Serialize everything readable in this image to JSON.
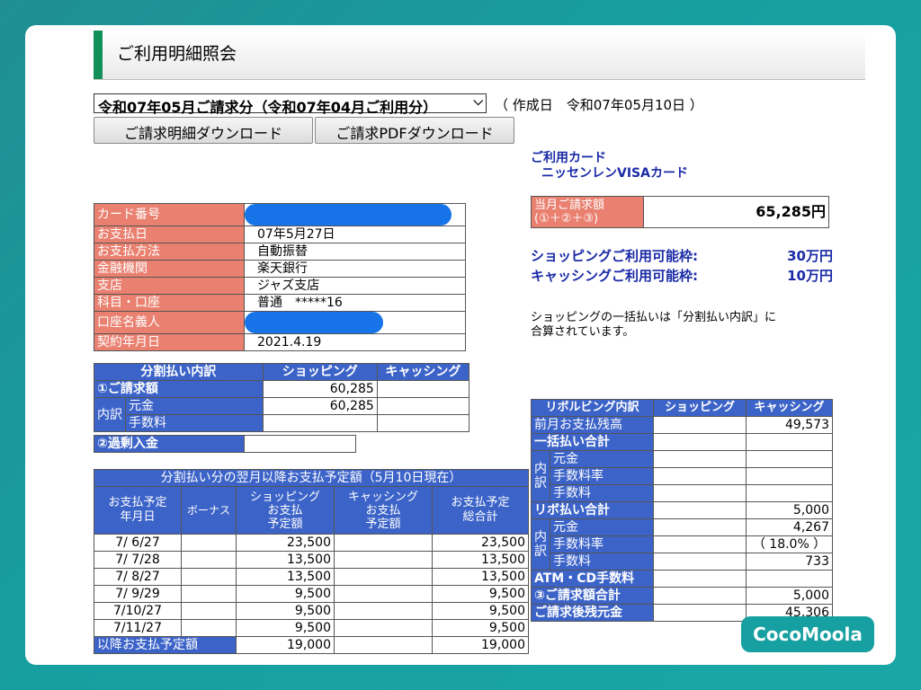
{
  "page": {
    "title": "ご利用明細照会"
  },
  "statement": {
    "selected": "令和07年05月ご請求分（令和07年04月ご利用分）",
    "created": "（ 作成日　令和07年05月10日 ）"
  },
  "buttons": {
    "download_detail": "ご請求明細ダウンロード",
    "download_pdf": "ご請求PDFダウンロード"
  },
  "card": {
    "label": "ご利用カード",
    "name": "ニッセンレンVISAカード"
  },
  "account": {
    "rows": [
      {
        "label": "カード番号",
        "value": ""
      },
      {
        "label": "お支払日",
        "value": "07年5月27日"
      },
      {
        "label": "お支払方法",
        "value": "自動振替"
      },
      {
        "label": "金融機関",
        "value": "楽天銀行"
      },
      {
        "label": "支店",
        "value": "ジャズ支店"
      },
      {
        "label": "科目・口座",
        "value": "普通　*****16"
      },
      {
        "label": "口座名義人",
        "value": ""
      },
      {
        "label": "契約年月日",
        "value": "2021.4.19"
      }
    ]
  },
  "billing_total": {
    "label_line1": "当月ご請求額",
    "label_line2": "(①＋②＋③)",
    "amount": "65,285円"
  },
  "limits": {
    "shopping_label": "ショッピングご利用可能枠:",
    "shopping_value": "30万円",
    "cashing_label": "キャッシングご利用可能枠:",
    "cashing_value": "10万円"
  },
  "note": {
    "line1": "ショッピングの一括払いは「分割払い内訳」に",
    "line2": "合算されています。"
  },
  "installments": {
    "h0": "分割払い内訳",
    "h1": "ショッピング",
    "h2": "キャッシング",
    "billed_label": "①ご請求額",
    "billed_shopping": "60,285",
    "breakdown_label": "内訳",
    "principal_label": "元金",
    "principal_shopping": "60,285",
    "fee_label": "手数料",
    "overpay_label": "②過剰入金"
  },
  "schedule": {
    "title": "分割払い分の翌月以降お支払予定額（5月10日現在）",
    "col_date": "お支払予定\n年月日",
    "col_bonus": "ボーナス",
    "col_shopping": "ショッピング\nお支払\n予定額",
    "col_cashing": "キャッシング\nお支払\n予定額",
    "col_total": "お支払予定\n総合計",
    "rows": [
      {
        "date": "7/ 6/27",
        "shopping": "23,500",
        "total": "23,500"
      },
      {
        "date": "7/ 7/28",
        "shopping": "13,500",
        "total": "13,500"
      },
      {
        "date": "7/ 8/27",
        "shopping": "13,500",
        "total": "13,500"
      },
      {
        "date": "7/ 9/29",
        "shopping": "9,500",
        "total": "9,500"
      },
      {
        "date": "7/10/27",
        "shopping": "9,500",
        "total": "9,500"
      },
      {
        "date": "7/11/27",
        "shopping": "9,500",
        "total": "9,500"
      }
    ],
    "after_label": "以降お支払予定額",
    "after_shopping": "19,000",
    "after_total": "19,000"
  },
  "revolving": {
    "h0": "リボルビング内訳",
    "h1": "ショッピング",
    "h2": "キャッシング",
    "prev_balance_label": "前月お支払残高",
    "prev_balance_cashing": "49,573",
    "lump_total_label": "一括払い合計",
    "breakdown_label": "内訳",
    "principal_label": "元金",
    "rate_label": "手数料率",
    "fee_label": "手数料",
    "revo_total_label": "リボ払い合計",
    "revo_total_cashing": "5,000",
    "revo_principal_cashing": "4,267",
    "revo_rate_cashing": "（ 18.0% ）",
    "revo_fee_cashing": "733",
    "atm_label": "ATM・CD手数料",
    "billed_total_label": "③ご請求額合計",
    "billed_total_cashing": "5,000",
    "remaining_label": "ご請求後残元金",
    "remaining_cashing": "45,306"
  },
  "watermark": {
    "text": "CocoMoola"
  },
  "colors": {
    "label_pink": "#e98070",
    "header_blue": "#3c63c8",
    "accent_green": "#12905a",
    "frame_teal": "#17a0a1",
    "redaction_blue": "#1673e8"
  }
}
